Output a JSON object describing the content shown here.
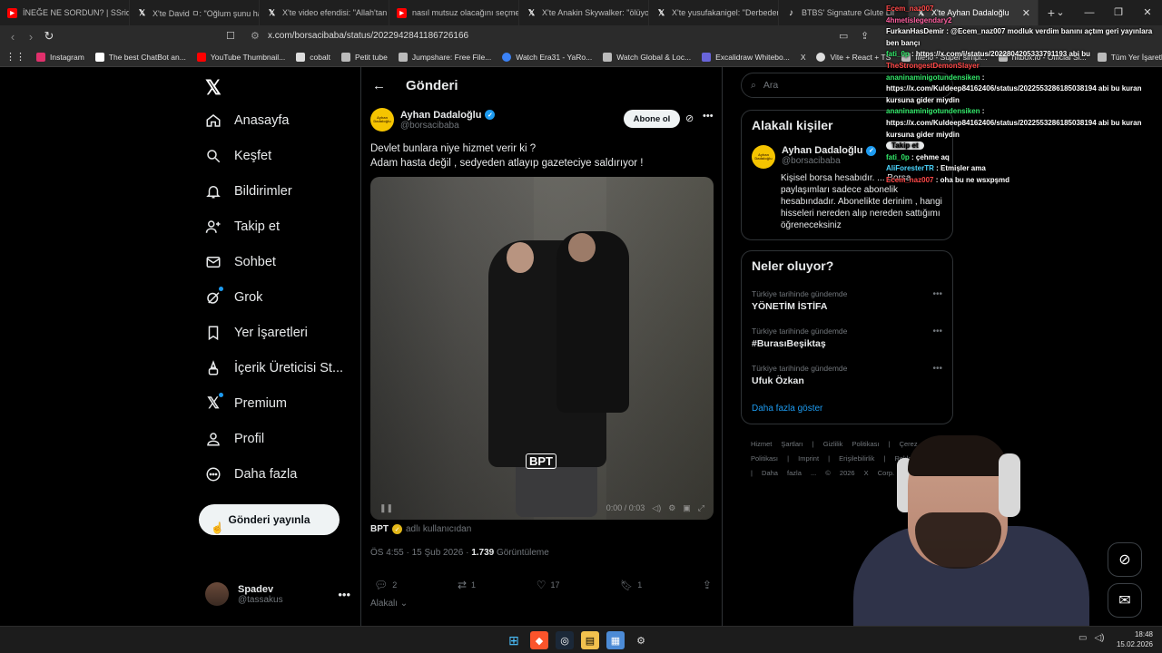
{
  "browser": {
    "tabs": [
      {
        "label": "İNEĞE NE SORDUN? | SSriders",
        "icon": "youtube-icon"
      },
      {
        "label": "X'te David ㅁ: \"Oğlum şunu ha",
        "icon": "x-icon"
      },
      {
        "label": "X'te video efendisi: \"Allah'tan",
        "icon": "x-icon"
      },
      {
        "label": "nasıl mutsuz olacağını seçmen",
        "icon": "youtube-icon"
      },
      {
        "label": "X'te Anakin Skywalker: \"ölüyo",
        "icon": "x-icon"
      },
      {
        "label": "X'te yusufakanigel: \"Derbeder",
        "icon": "x-icon"
      },
      {
        "label": "BTBS' Signature Glute Lif",
        "icon": "tiktok-icon"
      },
      {
        "label": "X'te Ayhan Dadaloğlu",
        "icon": "x-icon"
      }
    ],
    "url": "x.com/borsacibaba/status/2022942841186726166",
    "bookmarks": [
      {
        "label": "Instagram",
        "color": "#e1306c"
      },
      {
        "label": "The best ChatBot an...",
        "color": "#ffffff"
      },
      {
        "label": "YouTube Thumbnail...",
        "color": "#ff0000"
      },
      {
        "label": "cobalt",
        "color": "#ffffff"
      },
      {
        "label": "Petit tube",
        "color": "#ffffff"
      },
      {
        "label": "Jumpshare: Free File...",
        "color": "#f5a623"
      },
      {
        "label": "Watch Era31 - YaRo...",
        "color": "#3b82f6"
      },
      {
        "label": "Watch Global & Loc...",
        "color": "#ffffff"
      },
      {
        "label": "Excalidraw Whitebo...",
        "color": "#6965db"
      },
      {
        "label": "X",
        "color": "#ffffff"
      },
      {
        "label": "Vite + React + TS",
        "color": "#ffffff"
      },
      {
        "label": "file.io - Super simpl...",
        "color": "#ffffff"
      },
      {
        "label": "hitbox.io - Official Si...",
        "color": "#ffffff"
      }
    ],
    "all_bookmarks": "Tüm Yer İşaretleri"
  },
  "sidebar": {
    "items": [
      {
        "label": "Anasayfa",
        "icon": "home-icon"
      },
      {
        "label": "Keşfet",
        "icon": "search-icon"
      },
      {
        "label": "Bildirimler",
        "icon": "bell-icon"
      },
      {
        "label": "Takip et",
        "icon": "add-user-icon"
      },
      {
        "label": "Sohbet",
        "icon": "mail-icon"
      },
      {
        "label": "Grok",
        "icon": "grok-icon"
      },
      {
        "label": "Yer İşaretleri",
        "icon": "bookmark-icon"
      },
      {
        "label": "İçerik Üreticisi St...",
        "icon": "creator-studio-icon"
      },
      {
        "label": "Premium",
        "icon": "x-icon"
      },
      {
        "label": "Profil",
        "icon": "profile-icon"
      },
      {
        "label": "Daha fazla",
        "icon": "more-circle-icon"
      }
    ],
    "post_button": "Gönderi yayınla",
    "account": {
      "name": "Spadev",
      "handle": "@tassakus"
    }
  },
  "post": {
    "header_title": "Gönderi",
    "author_name": "Ayhan Dadaloğlu",
    "author_handle": "@borsacibaba",
    "avatar_text": "Ayhan Dadaloğlu",
    "subscribe_label": "Abone ol",
    "text_line1": "Devlet bunlara niye hizmet verir ki ?",
    "text_line2": "Adam hasta değil , sedyeden atlayıp gazeteciye saldırıyor !",
    "video_watermark": "BPT",
    "video_time": "0:00 / 0:03",
    "source_name": "BPT",
    "source_suffix": "adlı kullanıcıdan",
    "timestamp": "ÖS 4:55 · 15 Şub 2026 ·",
    "views": "1.739",
    "views_label": "Görüntüleme",
    "replies": "2",
    "reposts": "1",
    "likes": "17",
    "bookmarks": "1",
    "related_label": "Alakalı"
  },
  "right": {
    "search_placeholder": "Ara",
    "related_people_title": "Alakalı kişiler",
    "person_name": "Ayhan Dadaloğlu",
    "person_handle": "@borsacibaba",
    "person_bio": "Kişisel borsa hesabıdır. ... Borsa paylaşımları sadece abonelik hesabındadır. Abonelikte derinim , hangi hisseleri nereden alıp nereden sattığımı öğreneceksiniz",
    "follow_label": "Takip et",
    "trends_title": "Neler oluyor?",
    "trends": [
      {
        "sub": "Türkiye tarihinde gündemde",
        "title": "YÖNETİM İSTİFA"
      },
      {
        "sub": "Türkiye tarihinde gündemde",
        "title": "#BurasıBeşiktaş"
      },
      {
        "sub": "Türkiye tarihinde gündemde",
        "title": "Ufuk Özkan"
      }
    ],
    "show_more": "Daha fazla göster",
    "footer": "Hizmet Şartları | Gizlilik Politikası | Çerez Politikası | Imprint | Erişilebilirlik | Reklam bilgisi | Daha fazla ... © 2026 X Corp."
  },
  "chat": [
    {
      "name": "Ecem_naz007",
      "msg": "",
      "color": "red"
    },
    {
      "name": "4hmetislegendary2",
      "msg": "",
      "color": "pink"
    },
    {
      "name": "FurkanHasDemir",
      "msg": "@Ecem_naz007 modluk verdim banını açtım geri yayınlara ben bançı",
      "color": "white"
    },
    {
      "name": "fati_0p",
      "msg": "https://x.com/i/status/2022804205333791193 abi bu",
      "color": "green"
    },
    {
      "name": "TheStrongestDemonSlayer",
      "msg": "",
      "color": "red"
    },
    {
      "name": "ananinaminigotundensiken",
      "msg": "https://x.com/Kuldeep84162406/status/2022553286185038194 abi bu kuran kursuna gider miydin",
      "color": "green"
    },
    {
      "name": "ananinaminigotundensiken",
      "msg": "https://x.com/Kuldeep84162406/status/2022553286185038194 abi bu kuran kursuna gider miydin",
      "color": "green"
    },
    {
      "name": "fati_0p",
      "msg": "çehme aq",
      "color": "green"
    },
    {
      "name": "AliForesterTR",
      "msg": "Etmişler ama",
      "color": "cyan"
    },
    {
      "name": "Ecem_naz007",
      "msg": "oha bu ne wsxpşmd",
      "color": "red"
    }
  ],
  "taskbar": {
    "time": "18:48",
    "date": "15.02.2026"
  }
}
